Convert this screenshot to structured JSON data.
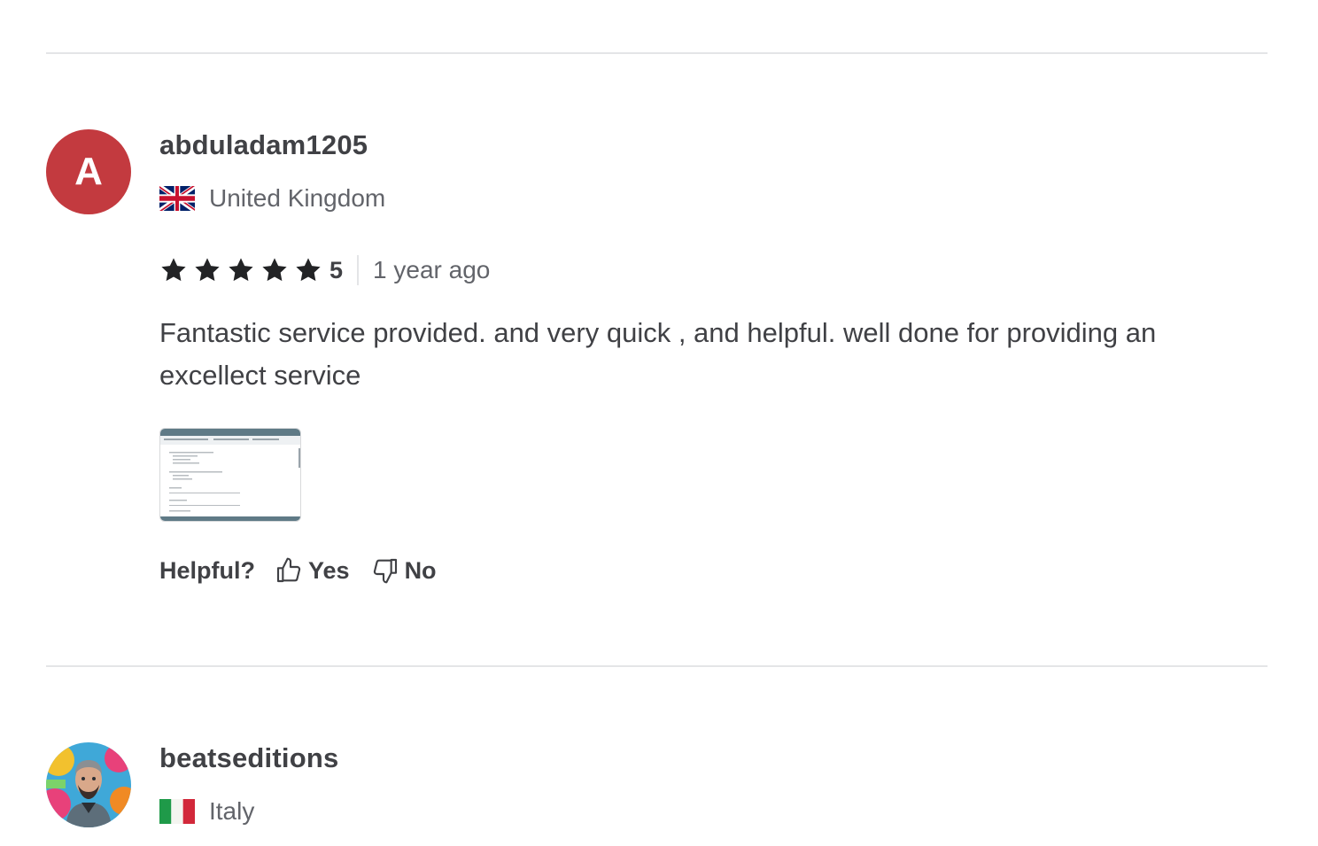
{
  "reviews": [
    {
      "avatar_letter": "A",
      "avatar_color": "#c33a3f",
      "username": "abduladam1205",
      "country": "United Kingdom",
      "flag": "uk-flag",
      "rating": "5",
      "time": "1 year ago",
      "text": "Fantastic service provided. and very quick , and helpful. well done for providing an excellect service",
      "helpful_label": "Helpful?",
      "yes_label": "Yes",
      "no_label": "No"
    },
    {
      "username": "beatseditions",
      "country": "Italy",
      "flag": "italy-flag"
    }
  ],
  "colors": {
    "text": "#404145",
    "muted": "#62646a",
    "divider": "#e4e5e7"
  }
}
